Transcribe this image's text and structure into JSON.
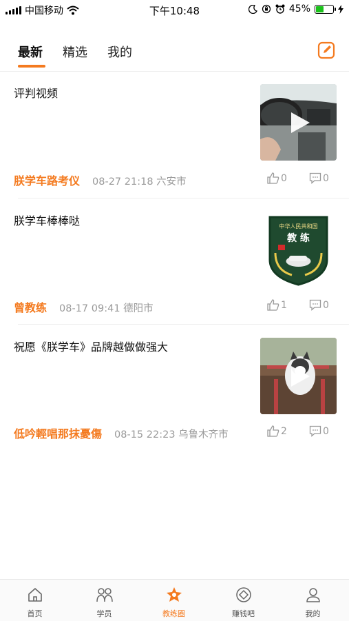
{
  "status_bar": {
    "carrier": "中国移动",
    "time": "下午10:48",
    "battery_percent": "45%",
    "battery_level": 0.45,
    "battery_color": "#1bc21b"
  },
  "tabs": [
    {
      "label": "最新",
      "active": true
    },
    {
      "label": "精选",
      "active": false
    },
    {
      "label": "我的",
      "active": false
    }
  ],
  "accent_color": "#f47a1f",
  "header": {
    "compose_icon": "edit-icon"
  },
  "posts": [
    {
      "title": "评判视频",
      "author": "朕学车路考仪",
      "time": "08-27 21:18 六安市",
      "likes": "0",
      "comments": "0",
      "thumb": "car-interior-video",
      "is_video": true
    },
    {
      "title": "朕学车棒棒哒",
      "author": "曾教练",
      "time": "08-17 09:41 德阳市",
      "likes": "1",
      "comments": "0",
      "thumb": "coach-badge",
      "badge_text": "中华人民共和国",
      "badge_title": "教 练",
      "is_video": false
    },
    {
      "title": "祝愿《朕学车》品牌越做做强大",
      "author": "低吟輕唱那抹憂傷",
      "time": "08-15 22:23 乌鲁木齐市",
      "likes": "2",
      "comments": "0",
      "thumb": "husky-dog-video",
      "is_video": true
    }
  ],
  "bottom_nav": [
    {
      "label": "首页",
      "icon": "home-icon",
      "active": false
    },
    {
      "label": "学员",
      "icon": "students-icon",
      "active": false
    },
    {
      "label": "教练圈",
      "icon": "coach-circle-icon",
      "active": true
    },
    {
      "label": "赚钱吧",
      "icon": "earn-money-icon",
      "active": false
    },
    {
      "label": "我的",
      "icon": "profile-icon",
      "active": false
    }
  ]
}
